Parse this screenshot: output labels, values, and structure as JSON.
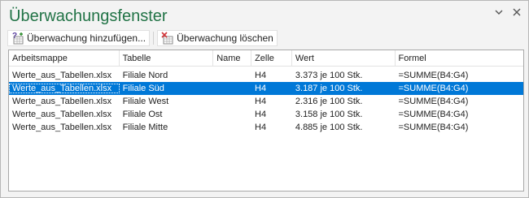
{
  "window": {
    "title": "Überwachungsfenster"
  },
  "toolbar": {
    "add_watch_label": "Überwachung hinzufügen...",
    "delete_watch_label": "Überwachung löschen"
  },
  "table": {
    "columns": [
      "Arbeitsmappe",
      "Tabelle",
      "Name",
      "Zelle",
      "Wert",
      "Formel"
    ],
    "rows": [
      {
        "arbeitsmappe": "Werte_aus_Tabellen.xlsx",
        "tabelle": "Filiale Nord",
        "name": "",
        "zelle": "H4",
        "wert": "3.373 je 100 Stk.",
        "formel": "=SUMME(B4:G4)",
        "selected": false
      },
      {
        "arbeitsmappe": "Werte_aus_Tabellen.xlsx",
        "tabelle": "Filiale Süd",
        "name": "",
        "zelle": "H4",
        "wert": "3.187 je 100 Stk.",
        "formel": "=SUMME(B4:G4)",
        "selected": true
      },
      {
        "arbeitsmappe": "Werte_aus_Tabellen.xlsx",
        "tabelle": "Filiale West",
        "name": "",
        "zelle": "H4",
        "wert": "2.316 je 100 Stk.",
        "formel": "=SUMME(B4:G4)",
        "selected": false
      },
      {
        "arbeitsmappe": "Werte_aus_Tabellen.xlsx",
        "tabelle": "Filiale Ost",
        "name": "",
        "zelle": "H4",
        "wert": "3.158 je 100 Stk.",
        "formel": "=SUMME(B4:G4)",
        "selected": false
      },
      {
        "arbeitsmappe": "Werte_aus_Tabellen.xlsx",
        "tabelle": "Filiale Mitte",
        "name": "",
        "zelle": "H4",
        "wert": "4.885 je 100 Stk.",
        "formel": "=SUMME(B4:G4)",
        "selected": false
      }
    ]
  },
  "colors": {
    "title": "#217346",
    "selection": "#0078d7"
  },
  "icons": {
    "add": "add-watch-icon",
    "delete": "delete-watch-icon",
    "dropdown": "chevron-down-icon",
    "close": "close-icon"
  }
}
